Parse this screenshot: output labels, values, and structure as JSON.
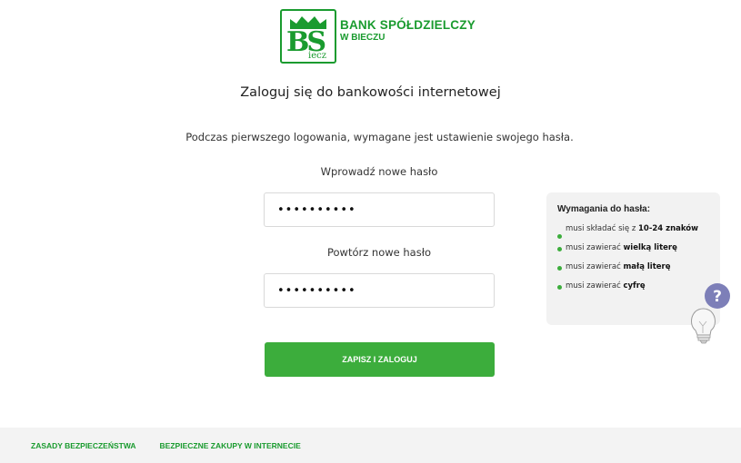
{
  "brand": {
    "name_line1": "BANK SPÓŁDZIELCZY",
    "name_line2": "W BIECZU",
    "logo_letters": "BS",
    "logo_small": "iecz",
    "color": "#1a9b2f"
  },
  "page": {
    "title": "Zaloguj się do bankowości internetowej",
    "info": "Podczas pierwszego logowania, wymagane jest ustawienie swojego hasła."
  },
  "form": {
    "new_password_label": "Wprowadź nowe hasło",
    "new_password_value": "••••••••••",
    "repeat_password_label": "Powtórz nowe hasło",
    "repeat_password_value": "••••••••••",
    "submit_label": "ZAPISZ I ZALOGUJ",
    "submit_color": "#3cad3c"
  },
  "requirements": {
    "title": "Wymagania do hasła:",
    "items": [
      {
        "text": "musi składać się z ",
        "strong": "10-24 znaków"
      },
      {
        "text": "musi zawierać ",
        "strong": "wielką literę"
      },
      {
        "text": "musi zawierać ",
        "strong": "małą literę"
      },
      {
        "text": "musi zawierać ",
        "strong": "cyfrę"
      }
    ],
    "help_icon": "lightbulb-question-icon"
  },
  "footer": {
    "links": [
      "ZASADY BEZPIECZEŃSTWA",
      "BEZPIECZNE ZAKUPY W INTERNECIE"
    ]
  }
}
